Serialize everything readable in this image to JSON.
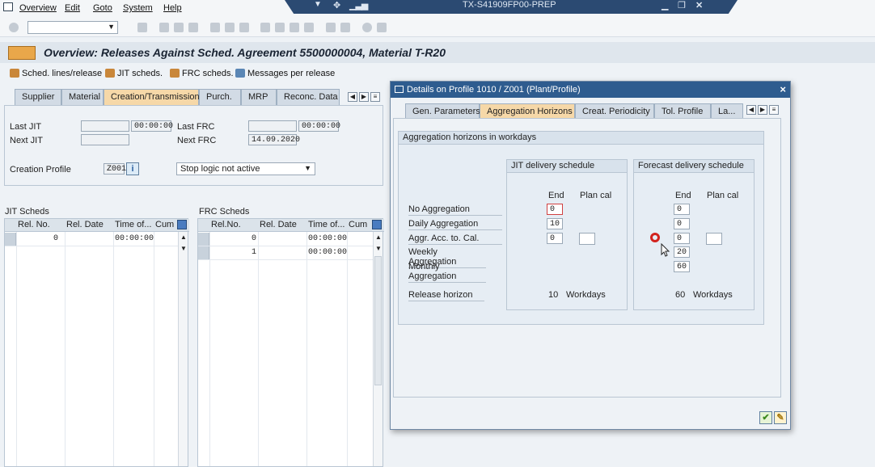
{
  "menubar": {
    "items": [
      "Overview",
      "Edit",
      "Goto",
      "System",
      "Help"
    ]
  },
  "system_title": "TX-S41909FP00-PREP",
  "screen": {
    "title": "Overview: Releases Against Sched. Agreement 5500000004, Material T-R20"
  },
  "app_toolbar": [
    {
      "label": "Sched. lines/release"
    },
    {
      "label": "JIT scheds."
    },
    {
      "label": "FRC scheds."
    },
    {
      "label": "Messages per release"
    }
  ],
  "main_tabs": [
    "Supplier",
    "Material",
    "Creation/Transmission",
    "Purch.",
    "MRP",
    "Reconc. Data"
  ],
  "creation": {
    "last_jit_label": "Last JIT",
    "last_jit_time": "00:00:00",
    "next_jit_label": "Next JIT",
    "last_frc_label": "Last FRC",
    "last_frc_time": "00:00:00",
    "next_frc_label": "Next FRC",
    "next_frc_date": "14.09.2020",
    "profile_label": "Creation Profile",
    "profile_value": "Z001",
    "stop_logic": "Stop logic not active"
  },
  "jit_table": {
    "title": "JIT Scheds",
    "columns": [
      "Rel. No.",
      "Rel. Date",
      "Time of...",
      "Cum. I"
    ],
    "rows": [
      {
        "rel_no": "0",
        "time": "00:00:00"
      }
    ]
  },
  "frc_table": {
    "title": "FRC Scheds",
    "columns": [
      "Rel.No.",
      "Rel. Date",
      "Time of...",
      "Cum. I"
    ],
    "rows": [
      {
        "rel_no": "0",
        "time": "00:00:00"
      },
      {
        "rel_no": "1",
        "time": "00:00:00"
      }
    ]
  },
  "dialog": {
    "title": "Details on Profile 1010 / Z001 (Plant/Profile)",
    "tabs": [
      "Gen. Parameters",
      "Aggregation Horizons",
      "Creat. Periodicity",
      "Tol. Profile",
      "La..."
    ],
    "section_title": "Aggregation horizons in workdays",
    "row_labels": [
      "No Aggregation",
      "Daily Aggregation",
      "Aggr. Acc. to. Cal.",
      "Weekly Aggregation",
      "Monthly Aggregation",
      "Release horizon"
    ],
    "jit": {
      "title": "JIT delivery schedule",
      "end_label": "End",
      "plan_label": "Plan cal",
      "no_agg": "0",
      "daily": "10",
      "cal": "0",
      "release": "10",
      "unit": "Workdays"
    },
    "frc": {
      "title": "Forecast delivery schedule",
      "end_label": "End",
      "plan_label": "Plan cal",
      "no_agg": "0",
      "daily": "0",
      "cal": "0",
      "weekly": "20",
      "monthly": "60",
      "release": "60",
      "unit": "Workdays"
    }
  }
}
